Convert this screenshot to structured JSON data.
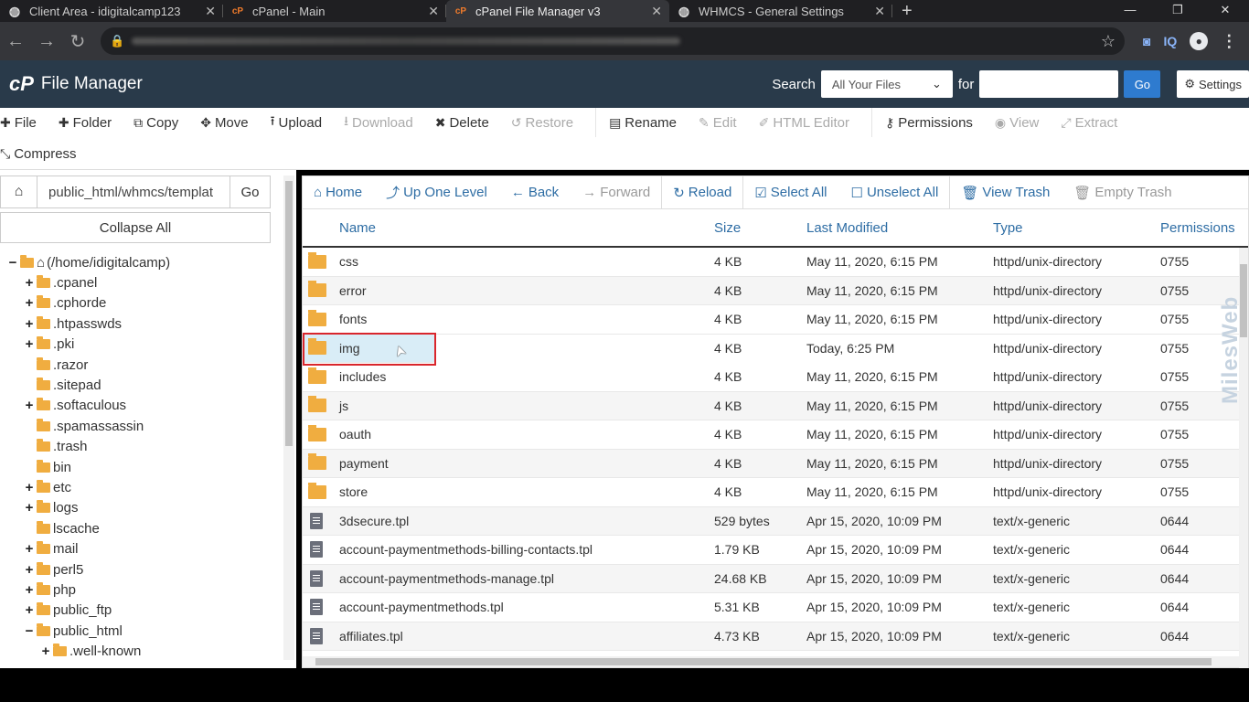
{
  "browser": {
    "tabs": [
      {
        "title": "Client Area - idigitalcamp123",
        "icon": "globe-icon",
        "active": false
      },
      {
        "title": "cPanel - Main",
        "icon": "cpanel-icon",
        "active": false
      },
      {
        "title": "cPanel File Manager v3",
        "icon": "cpanel-icon",
        "active": true
      },
      {
        "title": "WHMCS - General Settings",
        "icon": "globe-icon",
        "active": false
      }
    ],
    "ext_label": "IQ"
  },
  "header": {
    "logo": "cP",
    "app_title": "File Manager",
    "search_label": "Search",
    "search_scope": "All Your Files",
    "for_label": "for",
    "search_value": "",
    "go_label": "Go",
    "settings_label": "Settings"
  },
  "toolbar": {
    "row1": [
      {
        "label": "File",
        "icon": "plus-icon",
        "enabled": true
      },
      {
        "label": "Folder",
        "icon": "plus-icon",
        "enabled": true
      },
      {
        "label": "Copy",
        "icon": "copy-icon",
        "enabled": true
      },
      {
        "label": "Move",
        "icon": "move-icon",
        "enabled": true
      },
      {
        "label": "Upload",
        "icon": "upload-icon",
        "enabled": true
      },
      {
        "label": "Download",
        "icon": "download-icon",
        "enabled": false
      },
      {
        "label": "Delete",
        "icon": "times-icon",
        "enabled": true
      },
      {
        "label": "Restore",
        "icon": "undo-icon",
        "enabled": false
      },
      {
        "label": "Rename",
        "icon": "file-icon",
        "enabled": true
      },
      {
        "label": "Edit",
        "icon": "pencil-icon",
        "enabled": false
      },
      {
        "label": "HTML Editor",
        "icon": "edit-icon",
        "enabled": false
      },
      {
        "label": "Permissions",
        "icon": "key-icon",
        "enabled": true
      },
      {
        "label": "View",
        "icon": "eye-icon",
        "enabled": false
      },
      {
        "label": "Extract",
        "icon": "expand-icon",
        "enabled": false
      }
    ],
    "row2": [
      {
        "label": "Compress",
        "icon": "compress-icon",
        "enabled": true
      }
    ]
  },
  "sidebar": {
    "path_value": "public_html/whmcs/templat",
    "go_label": "Go",
    "collapse_label": "Collapse All",
    "tree": [
      {
        "label": "(/home/idigitalcamp)",
        "level": 0,
        "expander": "−",
        "home": true
      },
      {
        "label": ".cpanel",
        "level": 1,
        "expander": "+"
      },
      {
        "label": ".cphorde",
        "level": 1,
        "expander": "+"
      },
      {
        "label": ".htpasswds",
        "level": 1,
        "expander": "+"
      },
      {
        "label": ".pki",
        "level": 1,
        "expander": "+"
      },
      {
        "label": ".razor",
        "level": 1,
        "expander": ""
      },
      {
        "label": ".sitepad",
        "level": 1,
        "expander": ""
      },
      {
        "label": ".softaculous",
        "level": 1,
        "expander": "+"
      },
      {
        "label": ".spamassassin",
        "level": 1,
        "expander": ""
      },
      {
        "label": ".trash",
        "level": 1,
        "expander": ""
      },
      {
        "label": "bin",
        "level": 1,
        "expander": ""
      },
      {
        "label": "etc",
        "level": 1,
        "expander": "+"
      },
      {
        "label": "logs",
        "level": 1,
        "expander": "+"
      },
      {
        "label": "lscache",
        "level": 1,
        "expander": ""
      },
      {
        "label": "mail",
        "level": 1,
        "expander": "+"
      },
      {
        "label": "perl5",
        "level": 1,
        "expander": "+"
      },
      {
        "label": "php",
        "level": 1,
        "expander": "+"
      },
      {
        "label": "public_ftp",
        "level": 1,
        "expander": "+"
      },
      {
        "label": "public_html",
        "level": 1,
        "expander": "−"
      },
      {
        "label": ".well-known",
        "level": 2,
        "expander": "+"
      }
    ]
  },
  "navbar": [
    {
      "label": "Home",
      "icon": "home-icon",
      "enabled": true
    },
    {
      "label": "Up One Level",
      "icon": "level-up-icon",
      "enabled": true
    },
    {
      "label": "Back",
      "icon": "arrow-left-icon",
      "enabled": true
    },
    {
      "label": "Forward",
      "icon": "arrow-right-icon",
      "enabled": false
    },
    {
      "label": "Reload",
      "icon": "refresh-icon",
      "enabled": true
    },
    {
      "label": "Select All",
      "icon": "check-square-icon",
      "enabled": true
    },
    {
      "label": "Unselect All",
      "icon": "square-icon",
      "enabled": true
    },
    {
      "label": "View Trash",
      "icon": "trash-icon",
      "enabled": true
    },
    {
      "label": "Empty Trash",
      "icon": "trash-icon",
      "enabled": false
    }
  ],
  "table": {
    "columns": [
      "Name",
      "Size",
      "Last Modified",
      "Type",
      "Permissions"
    ],
    "rows": [
      {
        "kind": "folder",
        "name": "css",
        "size": "4 KB",
        "modified": "May 11, 2020, 6:15 PM",
        "type": "httpd/unix-directory",
        "perms": "0755"
      },
      {
        "kind": "folder",
        "name": "error",
        "size": "4 KB",
        "modified": "May 11, 2020, 6:15 PM",
        "type": "httpd/unix-directory",
        "perms": "0755"
      },
      {
        "kind": "folder",
        "name": "fonts",
        "size": "4 KB",
        "modified": "May 11, 2020, 6:15 PM",
        "type": "httpd/unix-directory",
        "perms": "0755"
      },
      {
        "kind": "folder",
        "name": "img",
        "size": "4 KB",
        "modified": "Today, 6:25 PM",
        "type": "httpd/unix-directory",
        "perms": "0755",
        "selected": true
      },
      {
        "kind": "folder",
        "name": "includes",
        "size": "4 KB",
        "modified": "May 11, 2020, 6:15 PM",
        "type": "httpd/unix-directory",
        "perms": "0755"
      },
      {
        "kind": "folder",
        "name": "js",
        "size": "4 KB",
        "modified": "May 11, 2020, 6:15 PM",
        "type": "httpd/unix-directory",
        "perms": "0755"
      },
      {
        "kind": "folder",
        "name": "oauth",
        "size": "4 KB",
        "modified": "May 11, 2020, 6:15 PM",
        "type": "httpd/unix-directory",
        "perms": "0755"
      },
      {
        "kind": "folder",
        "name": "payment",
        "size": "4 KB",
        "modified": "May 11, 2020, 6:15 PM",
        "type": "httpd/unix-directory",
        "perms": "0755"
      },
      {
        "kind": "folder",
        "name": "store",
        "size": "4 KB",
        "modified": "May 11, 2020, 6:15 PM",
        "type": "httpd/unix-directory",
        "perms": "0755"
      },
      {
        "kind": "file",
        "name": "3dsecure.tpl",
        "size": "529 bytes",
        "modified": "Apr 15, 2020, 10:09 PM",
        "type": "text/x-generic",
        "perms": "0644"
      },
      {
        "kind": "file",
        "name": "account-paymentmethods-billing-contacts.tpl",
        "size": "1.79 KB",
        "modified": "Apr 15, 2020, 10:09 PM",
        "type": "text/x-generic",
        "perms": "0644"
      },
      {
        "kind": "file",
        "name": "account-paymentmethods-manage.tpl",
        "size": "24.68 KB",
        "modified": "Apr 15, 2020, 10:09 PM",
        "type": "text/x-generic",
        "perms": "0644"
      },
      {
        "kind": "file",
        "name": "account-paymentmethods.tpl",
        "size": "5.31 KB",
        "modified": "Apr 15, 2020, 10:09 PM",
        "type": "text/x-generic",
        "perms": "0644"
      },
      {
        "kind": "file",
        "name": "affiliates.tpl",
        "size": "4.73 KB",
        "modified": "Apr 15, 2020, 10:09 PM",
        "type": "text/x-generic",
        "perms": "0644"
      }
    ]
  },
  "watermark": "MilesWeb",
  "colors": {
    "header_bg": "#293a4a",
    "link": "#2e6da4",
    "folder": "#f0ad40",
    "selected_row": "#d9edf7",
    "highlight_box": "#d9262c"
  }
}
